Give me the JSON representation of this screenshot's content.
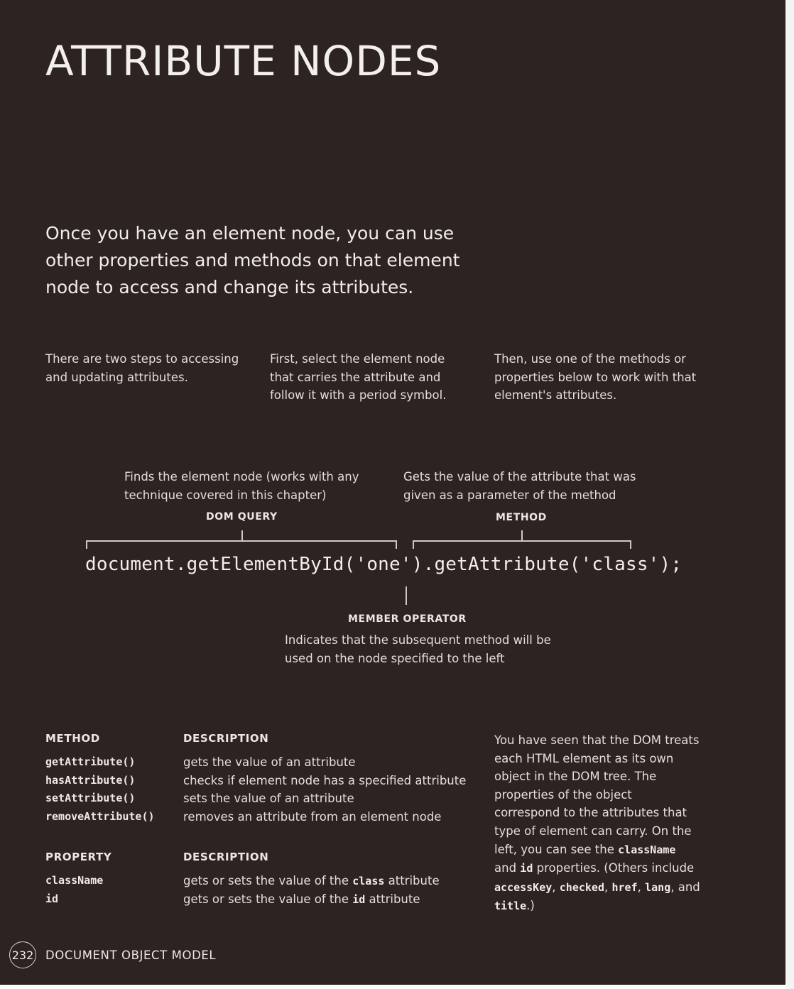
{
  "title": "ATTRIBUTE NODES",
  "intro": "Once you have an element node, you can use other properties and methods on that element node to access and change its attributes.",
  "steps": [
    "There are two steps to accessing and updating attributes.",
    "First, select the element node that carries the attribute and follow it with a period symbol.",
    "Then, use one of the methods or properties below to work with that element's attributes."
  ],
  "diagram": {
    "dom_query_desc": "Finds the element node (works with any technique covered in this chapter)",
    "dom_query_label": "DOM QUERY",
    "method_desc": "Gets the value of the attribute that was given as a parameter of the method",
    "method_label": "METHOD",
    "code": "document.getElementById('one').getAttribute('class');",
    "member_operator_label": "MEMBER OPERATOR",
    "member_operator_desc": "Indicates that the subsequent method will be used on the node specified to the left"
  },
  "methods_table": {
    "header_name": "METHOD",
    "header_desc": "DESCRIPTION",
    "rows": [
      {
        "name": "getAttribute()",
        "desc": "gets the value of an attribute"
      },
      {
        "name": "hasAttribute()",
        "desc": "checks if element node has a specified attribute"
      },
      {
        "name": "setAttribute()",
        "desc": "sets the value of an attribute"
      },
      {
        "name": "removeAttribute()",
        "desc": "removes an attribute from an element node"
      }
    ]
  },
  "properties_table": {
    "header_name": "PROPERTY",
    "header_desc": "DESCRIPTION",
    "rows": [
      {
        "name": "className",
        "desc_before": "gets or sets the value of the ",
        "keyword": "class",
        "desc_after": " attribute"
      },
      {
        "name": "id",
        "desc_before": "gets or sets the value of the ",
        "keyword": "id",
        "desc_after": " attribute"
      }
    ]
  },
  "side_note": {
    "text1": "You have seen that the DOM treats each HTML element as its own object in the DOM tree. The properties of the object correspond to the attributes that type of element can carry. On the left, you can see the ",
    "kw1": "className",
    "text2": " and ",
    "kw2": "id",
    "text3": " properties. (Others include ",
    "kw3": "accessKey",
    "text4": ", ",
    "kw4": "checked",
    "text5": ", ",
    "kw5": "href",
    "text6": ", ",
    "kw6": "lang",
    "text7": ", and ",
    "kw7": "title",
    "text8": ".)"
  },
  "footer": {
    "page_number": "232",
    "section_title": "DOCUMENT OBJECT MODEL"
  }
}
